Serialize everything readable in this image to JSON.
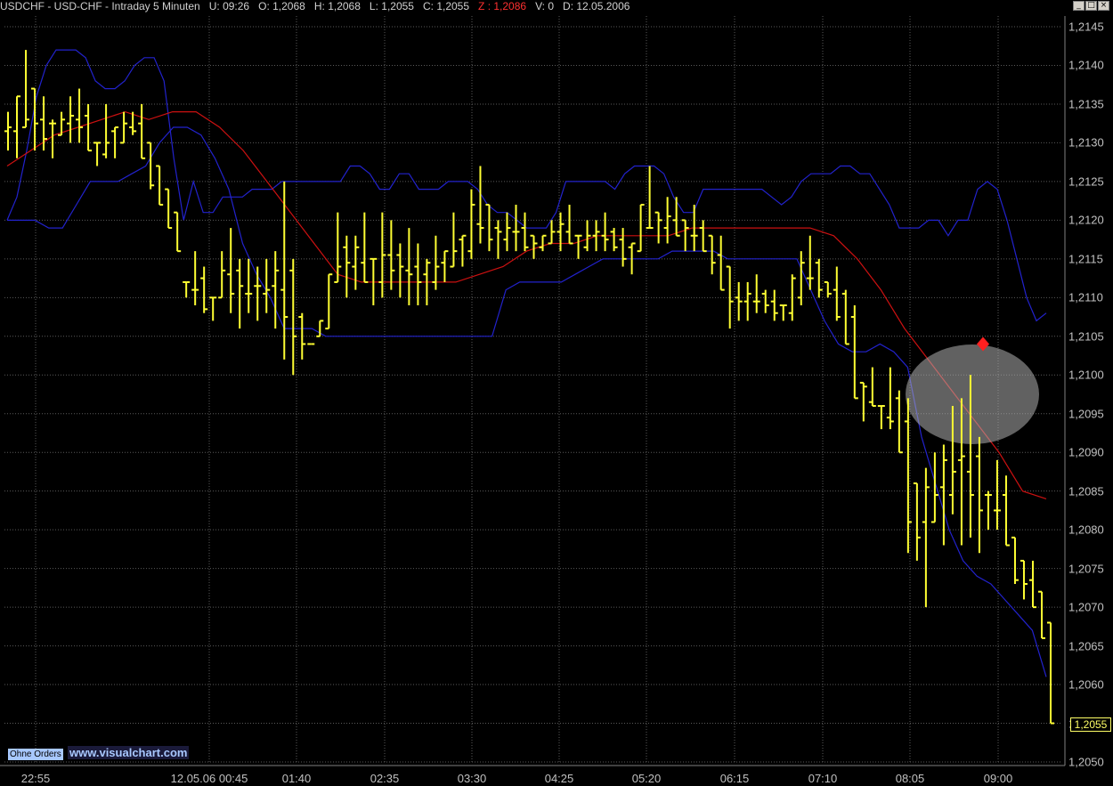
{
  "header": {
    "symbol": "USDCHF - USD-CHF - Intraday 5 Minuten",
    "u": "U: 09:26",
    "o": "O: 1,2068",
    "h": "H: 1,2068",
    "l": "L: 1,2055",
    "c": "C: 1,2055",
    "z": "Z : 1,2086",
    "v": "V: 0",
    "d": "D: 12.05.2006"
  },
  "window_buttons": [
    "_",
    "□",
    "×"
  ],
  "badges": {
    "orders": "Ohne Orders",
    "watermark": "www.visualchart.com"
  },
  "last_price": "1,2055",
  "colors": {
    "bars": "#ffff33",
    "bands": "#2222cc",
    "ma": "#cc1111",
    "grid": "#5a5a5a",
    "signal": "#ff2020",
    "highlight": "#b0b0b0"
  },
  "chart_data": {
    "type": "ohlc",
    "ylim": [
      1.205,
      1.2145
    ],
    "x_tick_labels": [
      "22:55",
      "12.05.06 00:45",
      "01:40",
      "02:35",
      "03:30",
      "04:25",
      "05:20",
      "06:15",
      "07:10",
      "08:05",
      "09:00"
    ],
    "y_tick_labels": [
      "1,2145",
      "1,2140",
      "1,2135",
      "1,2130",
      "1,2125",
      "1,2120",
      "1,2115",
      "1,2110",
      "1,2105",
      "1,2100",
      "1,2095",
      "1,2090",
      "1,2085",
      "1,2080",
      "1,2075",
      "1,2070",
      "1,2065",
      "1,2060",
      "1,2055",
      "1,2050"
    ],
    "bars": {
      "high": [
        1.2134,
        1.2136,
        1.2142,
        1.2137,
        1.2136,
        1.2133,
        1.2134,
        1.2136,
        1.2137,
        1.2135,
        1.213,
        1.2135,
        1.2132,
        1.2134,
        1.2134,
        1.2135,
        1.213,
        1.2127,
        1.2124,
        1.2121,
        1.2112,
        1.2116,
        1.2114,
        1.211,
        1.2116,
        1.2119,
        1.2115,
        1.2115,
        1.2114,
        1.2115,
        1.2116,
        1.2125,
        1.2115,
        1.2108,
        1.2104,
        1.2107,
        1.2113,
        1.2121,
        1.2118,
        1.2118,
        1.2121,
        1.2115,
        1.2121,
        1.212,
        1.2117,
        1.2119,
        1.2117,
        1.2115,
        1.2118,
        1.2116,
        1.2121,
        1.2118,
        1.2124,
        1.2127,
        1.2122,
        1.212,
        1.2121,
        1.2122,
        1.2121,
        1.2118,
        1.2118,
        1.212,
        1.2121,
        1.2122,
        1.2118,
        1.212,
        1.212,
        1.2121,
        1.2119,
        1.2119,
        1.2117,
        1.2122,
        1.2127,
        1.2121,
        1.2123,
        1.2123,
        1.212,
        1.2122,
        1.212,
        1.2118,
        1.2118,
        1.2114,
        1.2112,
        1.2112,
        1.2113,
        1.2111,
        1.2111,
        1.2109,
        1.2113,
        1.2116,
        1.2118,
        1.2115,
        1.2112,
        1.2114,
        1.2111,
        1.2109,
        1.2099,
        1.2101,
        1.2096,
        1.2101,
        1.2098,
        1.2097,
        1.2086,
        1.2088,
        1.209,
        1.2091,
        1.2096,
        1.2097,
        1.21,
        1.2092,
        1.2085,
        1.2089,
        1.2087,
        1.2079,
        1.2076,
        1.2076,
        1.2072,
        1.2068
      ],
      "low": [
        1.2129,
        1.2128,
        1.2132,
        1.2129,
        1.2129,
        1.2128,
        1.2131,
        1.213,
        1.213,
        1.2129,
        1.2127,
        1.2128,
        1.2128,
        1.213,
        1.2131,
        1.2128,
        1.2124,
        1.2122,
        1.2119,
        1.2116,
        1.211,
        1.2109,
        1.2108,
        1.2107,
        1.211,
        1.2108,
        1.2106,
        1.2108,
        1.2107,
        1.2108,
        1.2106,
        1.2102,
        1.21,
        1.2102,
        1.2104,
        1.2105,
        1.2106,
        1.2112,
        1.211,
        1.2111,
        1.2112,
        1.2109,
        1.211,
        1.2111,
        1.211,
        1.2109,
        1.2109,
        1.2109,
        1.2111,
        1.2112,
        1.2114,
        1.2114,
        1.2115,
        1.2117,
        1.2116,
        1.2115,
        1.2116,
        1.2116,
        1.2116,
        1.2115,
        1.2116,
        1.2117,
        1.2116,
        1.2117,
        1.2115,
        1.2116,
        1.2116,
        1.2116,
        1.2116,
        1.2114,
        1.2113,
        1.2116,
        1.2119,
        1.2117,
        1.2117,
        1.2118,
        1.2116,
        1.2116,
        1.2116,
        1.2113,
        1.2111,
        1.2106,
        1.2107,
        1.2107,
        1.2108,
        1.2108,
        1.2107,
        1.2107,
        1.2107,
        1.2109,
        1.2111,
        1.211,
        1.211,
        1.2107,
        1.2104,
        1.2097,
        1.2094,
        1.2096,
        1.2093,
        1.2093,
        1.209,
        1.2077,
        1.2076,
        1.207,
        1.2081,
        1.2078,
        1.2082,
        1.2078,
        1.2079,
        1.2077,
        1.208,
        1.208,
        1.2078,
        1.2073,
        1.2071,
        1.207,
        1.2066,
        1.2055
      ]
    },
    "upper_band": [
      1.212,
      1.2123,
      1.2129,
      1.2136,
      1.214,
      1.2142,
      1.2142,
      1.2142,
      1.2141,
      1.2138,
      1.2137,
      1.2137,
      1.2138,
      1.214,
      1.2141,
      1.2141,
      1.2138,
      1.2128,
      1.212,
      1.2125,
      1.2121,
      1.2121,
      1.2123,
      1.2123,
      1.2123,
      1.2124,
      1.2124,
      1.2124,
      1.2125,
      1.2125,
      1.2125,
      1.2125,
      1.2125,
      1.2125,
      1.2125,
      1.2127,
      1.2127,
      1.2126,
      1.2124,
      1.2124,
      1.2126,
      1.2126,
      1.2124,
      1.2124,
      1.2124,
      1.2125,
      1.2125,
      1.2125,
      1.2124,
      1.2122,
      1.2121,
      1.2121,
      1.212,
      1.2119,
      1.2119,
      1.2119,
      1.2121,
      1.2125,
      1.2125,
      1.2125,
      1.2125,
      1.2125,
      1.2124,
      1.2126,
      1.2127,
      1.2127,
      1.2127,
      1.2126,
      1.2123,
      1.2121,
      1.2121,
      1.2124,
      1.2124,
      1.2124,
      1.2124,
      1.2124,
      1.2124,
      1.2124,
      1.2123,
      1.2122,
      1.2123,
      1.2125,
      1.2126,
      1.2126,
      1.2126,
      1.2127,
      1.2127,
      1.2126,
      1.2126,
      1.2124,
      1.2122,
      1.2119,
      1.2119,
      1.2119,
      1.212,
      1.212,
      1.2118,
      1.212,
      1.212,
      1.2124,
      1.2125,
      1.2124,
      1.212,
      1.2115,
      1.211,
      1.2107,
      1.2108
    ],
    "lower_band": [
      1.212,
      1.212,
      1.212,
      1.2119,
      1.2119,
      1.2122,
      1.2125,
      1.2125,
      1.2125,
      1.2126,
      1.2127,
      1.213,
      1.2132,
      1.2132,
      1.2131,
      1.2128,
      1.2124,
      1.2117,
      1.2113,
      1.211,
      1.2106,
      1.2106,
      1.2106,
      1.2105,
      1.2105,
      1.2105,
      1.2105,
      1.2105,
      1.2105,
      1.2105,
      1.2105,
      1.2105,
      1.2105,
      1.2105,
      1.2105,
      1.2105,
      1.2111,
      1.2112,
      1.2112,
      1.2112,
      1.2112,
      1.2113,
      1.2114,
      1.2115,
      1.2115,
      1.2115,
      1.2115,
      1.2115,
      1.2116,
      1.2116,
      1.2116,
      1.2116,
      1.2115,
      1.2115,
      1.2115,
      1.2115,
      1.2115,
      1.2115,
      1.2111,
      1.2107,
      1.2104,
      1.2103,
      1.2103,
      1.2104,
      1.2103,
      1.2101,
      1.2092,
      1.2086,
      1.208,
      1.2076,
      1.2074,
      1.2073,
      1.2071,
      1.2069,
      1.2067,
      1.2061
    ],
    "moving_average": [
      1.2127,
      1.2129,
      1.2131,
      1.2132,
      1.2133,
      1.2134,
      1.2133,
      1.2134,
      1.2134,
      1.2132,
      1.2129,
      1.2125,
      1.2121,
      1.2117,
      1.2113,
      1.2112,
      1.2112,
      1.2112,
      1.2112,
      1.2112,
      1.2113,
      1.2114,
      1.2116,
      1.2117,
      1.2117,
      1.2118,
      1.2118,
      1.2118,
      1.2118,
      1.2119,
      1.2119,
      1.2119,
      1.2119,
      1.2119,
      1.2119,
      1.2118,
      1.2115,
      1.2111,
      1.2106,
      1.2102,
      1.2098,
      1.2094,
      1.209,
      1.2085,
      1.2084
    ],
    "signal_marker": {
      "value": 1.2104,
      "shape": "diamond"
    }
  }
}
